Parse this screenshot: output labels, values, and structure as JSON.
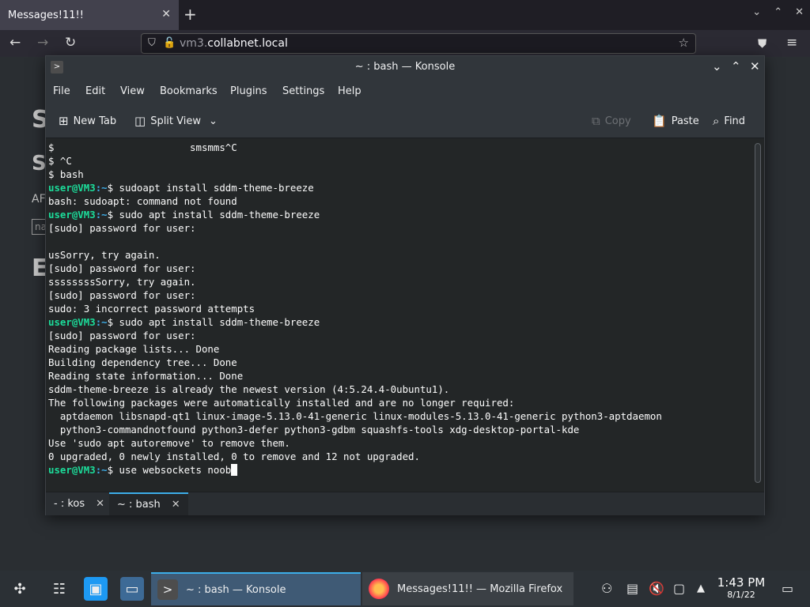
{
  "browser": {
    "tab_title": "Messages!11!!",
    "url_domain_pre": "vm3.",
    "url_domain": "collabnet.local"
  },
  "background_page": {
    "letters": [
      "S",
      "S",
      "AF",
      "na",
      "E"
    ]
  },
  "konsole": {
    "title": "~ : bash — Konsole",
    "menu": [
      "File",
      "Edit",
      "View",
      "Bookmarks",
      "Plugins",
      "Settings",
      "Help"
    ],
    "toolbar": {
      "new_tab": "New Tab",
      "split_view": "Split View",
      "copy": "Copy",
      "paste": "Paste",
      "find": "Find"
    },
    "prompt_user": "user@VM3",
    "prompt_path": ":~",
    "lines": [
      {
        "type": "text",
        "text": "$                       smsmms^C"
      },
      {
        "type": "text",
        "text": "$ ^C"
      },
      {
        "type": "text",
        "text": "$ bash"
      },
      {
        "type": "prompt",
        "text": "$ sudoapt install sddm-theme-breeze"
      },
      {
        "type": "text",
        "text": "bash: sudoapt: command not found"
      },
      {
        "type": "prompt",
        "text": "$ sudo apt install sddm-theme-breeze"
      },
      {
        "type": "text",
        "text": "[sudo] password for user:"
      },
      {
        "type": "text",
        "text": ""
      },
      {
        "type": "text",
        "text": "usSorry, try again."
      },
      {
        "type": "text",
        "text": "[sudo] password for user:"
      },
      {
        "type": "text",
        "text": "ssssssssSorry, try again."
      },
      {
        "type": "text",
        "text": "[sudo] password for user:"
      },
      {
        "type": "text",
        "text": "sudo: 3 incorrect password attempts"
      },
      {
        "type": "prompt",
        "text": "$ sudo apt install sddm-theme-breeze"
      },
      {
        "type": "text",
        "text": "[sudo] password for user:"
      },
      {
        "type": "text",
        "text": "Reading package lists... Done"
      },
      {
        "type": "text",
        "text": "Building dependency tree... Done"
      },
      {
        "type": "text",
        "text": "Reading state information... Done"
      },
      {
        "type": "text",
        "text": "sddm-theme-breeze is already the newest version (4:5.24.4-0ubuntu1)."
      },
      {
        "type": "text",
        "text": "The following packages were automatically installed and are no longer required:"
      },
      {
        "type": "text",
        "text": "  aptdaemon libsnapd-qt1 linux-image-5.13.0-41-generic linux-modules-5.13.0-41-generic python3-aptdaemon"
      },
      {
        "type": "text",
        "text": "  python3-commandnotfound python3-defer python3-gdbm squashfs-tools xdg-desktop-portal-kde"
      },
      {
        "type": "text",
        "text": "Use 'sudo apt autoremove' to remove them."
      },
      {
        "type": "text",
        "text": "0 upgraded, 0 newly installed, 0 to remove and 12 not upgraded."
      },
      {
        "type": "prompt",
        "text": "$ use websockets noob",
        "cursor": true
      }
    ],
    "tabs": [
      {
        "label": "- : kos",
        "active": false
      },
      {
        "label": "~ : bash",
        "active": true
      }
    ]
  },
  "taskbar": {
    "tasks": [
      {
        "label": "~ : bash — Konsole",
        "active": true
      },
      {
        "label": "Messages!11!! — Mozilla Firefox",
        "active": false
      }
    ],
    "clock_time": "1:43 PM",
    "clock_date": "8/1/22"
  },
  "colors": {
    "accent": "#3daee9",
    "prompt_user": "#1cdc9a",
    "terminal_bg": "#232627"
  },
  "icons": [
    "plasma-launcher-icon",
    "system-settings-icon",
    "discover-icon",
    "dolphin-icon",
    "konsole-icon",
    "firefox-icon",
    "network-icon",
    "clipboard-icon",
    "volume-muted-icon",
    "display-icon",
    "tray-expand-icon",
    "show-desktop-icon"
  ]
}
